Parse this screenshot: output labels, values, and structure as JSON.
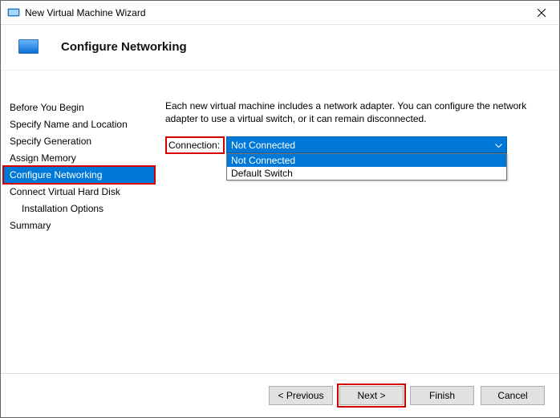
{
  "window": {
    "title": "New Virtual Machine Wizard",
    "page_title": "Configure Networking"
  },
  "sidebar": {
    "items": [
      {
        "label": "Before You Begin",
        "indent": false,
        "selected": false
      },
      {
        "label": "Specify Name and Location",
        "indent": false,
        "selected": false
      },
      {
        "label": "Specify Generation",
        "indent": false,
        "selected": false
      },
      {
        "label": "Assign Memory",
        "indent": false,
        "selected": false
      },
      {
        "label": "Configure Networking",
        "indent": false,
        "selected": true
      },
      {
        "label": "Connect Virtual Hard Disk",
        "indent": false,
        "selected": false
      },
      {
        "label": "Installation Options",
        "indent": true,
        "selected": false
      },
      {
        "label": "Summary",
        "indent": false,
        "selected": false
      }
    ]
  },
  "content": {
    "description": "Each new virtual machine includes a network adapter. You can configure the network adapter to use a virtual switch, or it can remain disconnected.",
    "connection_label": "Connection:",
    "connection_value": "Not Connected",
    "options": [
      {
        "label": "Not Connected",
        "selected": true
      },
      {
        "label": "Default Switch",
        "selected": false
      }
    ]
  },
  "footer": {
    "previous": "< Previous",
    "next": "Next >",
    "finish": "Finish",
    "cancel": "Cancel"
  }
}
